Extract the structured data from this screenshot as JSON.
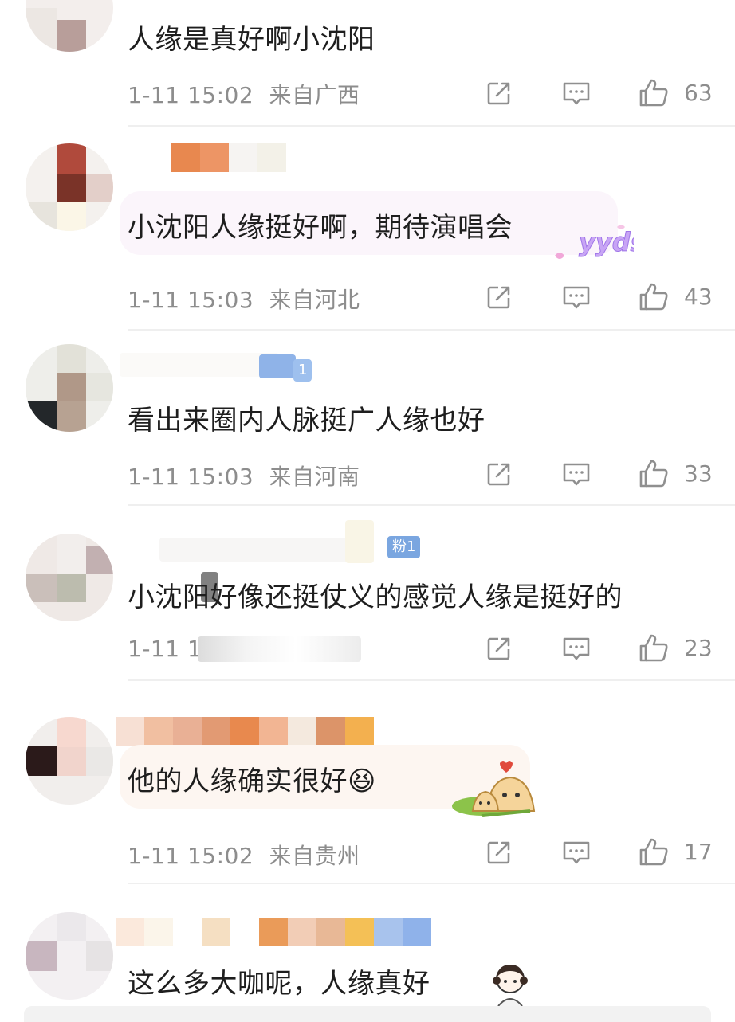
{
  "comments": [
    {
      "text": "人缘是真好啊小沈阳",
      "time": "1-11 15:02",
      "location": "来自广西",
      "likes": "63"
    },
    {
      "text": "小沈阳人缘挺好啊，期待演唱会",
      "time": "1-11 15:03",
      "location": "来自河北",
      "likes": "43",
      "sticker": "yyds"
    },
    {
      "text": "看出来圈内人脉挺广人缘也好",
      "time": "1-11 15:03",
      "location": "来自河南",
      "likes": "33",
      "badge": "1"
    },
    {
      "text": "小沈阳好像还挺仗义的感觉人缘是挺好的",
      "time": "1-11 1",
      "location": "",
      "likes": "23",
      "badge": "粉1"
    },
    {
      "text": "他的人缘确实很好😆",
      "time": "1-11 15:02",
      "location": "来自贵州",
      "likes": "17"
    },
    {
      "text": "这么多大咖呢，人缘真好",
      "time": "",
      "location": "",
      "likes": ""
    }
  ],
  "icons": {
    "share": "share-icon",
    "reply": "comment-icon",
    "like": "thumbs-up-icon"
  },
  "colors": {
    "text": "#1e1e1e",
    "meta": "#8d8d8d",
    "divider": "#efefef"
  }
}
